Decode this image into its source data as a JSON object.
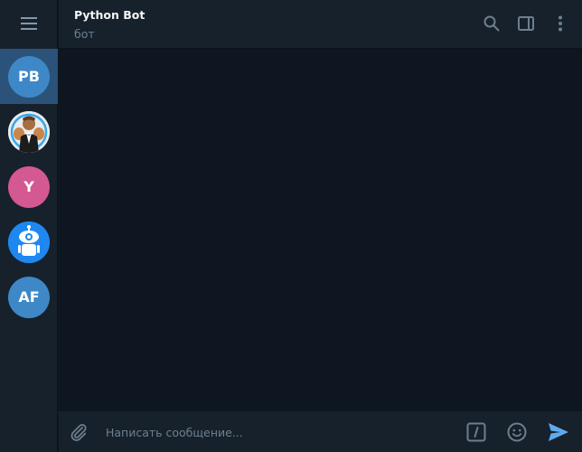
{
  "chat": {
    "title": "Python Bot",
    "status": "бот"
  },
  "sidebar": {
    "menu_icon": "hamburger-menu-icon",
    "chats": [
      {
        "initials": "PB",
        "color": "#3e88c7",
        "active": true
      },
      {
        "initials": "",
        "image": "man-in-tuxedo-photo",
        "color": "#e6e6e6"
      },
      {
        "initials": "Y",
        "color": "#d45892"
      },
      {
        "initials": "",
        "image": "robot-icon",
        "color": "#1e88f0"
      },
      {
        "initials": "AF",
        "color": "#3e88c7"
      }
    ]
  },
  "header": {
    "icons": [
      "search-icon",
      "sidebar-toggle-icon",
      "more-vertical-icon"
    ]
  },
  "compose": {
    "placeholder": "Написать сообщение...",
    "icons": [
      "attach-icon",
      "bot-command-icon",
      "emoji-icon",
      "send-icon"
    ]
  },
  "colors": {
    "background": "#0e1621",
    "panel": "#17212b",
    "active": "#2b5278",
    "accent": "#5eaaee",
    "icon": "#6d7f8f"
  }
}
